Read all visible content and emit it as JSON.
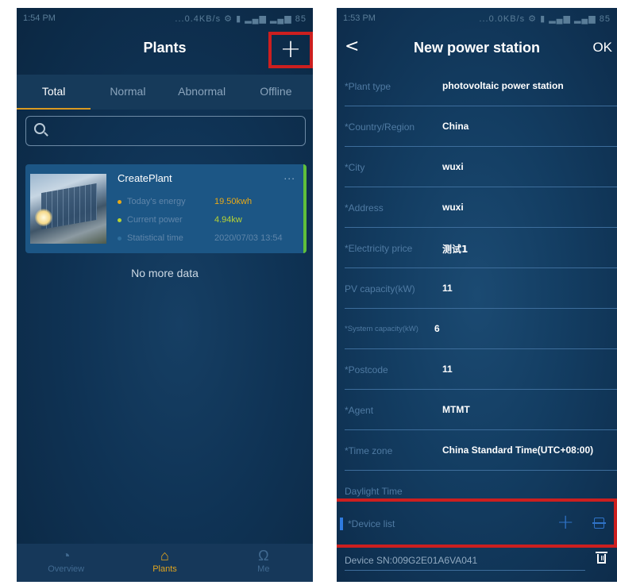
{
  "left": {
    "status": {
      "time": "1:54 PM",
      "network": "...0.4KB/s",
      "battery": "85"
    },
    "title": "Plants",
    "add_symbol": "+",
    "tabs": [
      "Total",
      "Normal",
      "Abnormal",
      "Offline"
    ],
    "active_tab": "Total",
    "search": {
      "placeholder": ""
    },
    "plant": {
      "name": "CreatePlant",
      "more": "...",
      "rows": [
        {
          "label": "Today's energy",
          "value": "19.50kwh",
          "color": "#e8a917"
        },
        {
          "label": "Current power",
          "value": "4.94kw",
          "color": "#b7d334"
        },
        {
          "label": "Statistical time",
          "value": "2020/07/03 13:54",
          "color": "#2f6f9e"
        }
      ],
      "status_color": "#5fbf3a"
    },
    "no_more": "No more data",
    "nav": [
      {
        "label": "Overview",
        "icon": "pie-chart-icon"
      },
      {
        "label": "Plants",
        "icon": "home-icon",
        "active": true
      },
      {
        "label": "Me",
        "icon": "user-icon"
      }
    ]
  },
  "right": {
    "status": {
      "time": "1:53 PM",
      "network": "...0.0KB/s",
      "battery": "85"
    },
    "back_symbol": "<",
    "title": "New power station",
    "ok": "OK",
    "fields": [
      {
        "label": "*Plant type",
        "value": "photovoltaic power station"
      },
      {
        "label": "*Country/Region",
        "value": "China"
      },
      {
        "label": "*City",
        "value": "wuxi"
      },
      {
        "label": "*Address",
        "value": "wuxi"
      },
      {
        "label": "*Electricity price",
        "value": "测试1"
      },
      {
        "label": "PV capacity(kW)",
        "value": "11"
      },
      {
        "label": "*System capacity(kW)",
        "value": "6"
      },
      {
        "label": "*Postcode",
        "value": "11"
      },
      {
        "label": "*Agent",
        "value": "MTMT"
      },
      {
        "label": "*Time zone",
        "value": "China Standard Time(UTC+08:00)"
      },
      {
        "label": "Daylight Time",
        "value": ""
      }
    ],
    "device_list_label": "*Device list",
    "add_symbol": "+",
    "device_sn": "Device SN:009G2E01A6VA041"
  }
}
